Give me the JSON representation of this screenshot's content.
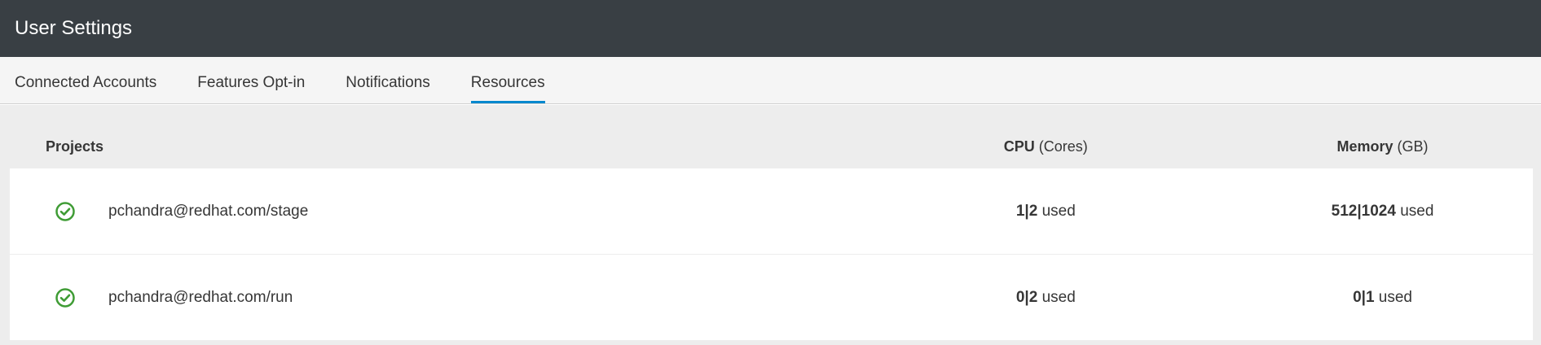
{
  "header": {
    "title": "User Settings"
  },
  "tabs": [
    {
      "label": "Connected Accounts"
    },
    {
      "label": "Features Opt-in"
    },
    {
      "label": "Notifications"
    },
    {
      "label": "Resources",
      "active": true
    }
  ],
  "table": {
    "columns": {
      "projects": "Projects",
      "cpu_bold": "CPU",
      "cpu_unit": "(Cores)",
      "memory_bold": "Memory",
      "memory_unit": "(GB)"
    },
    "rows": [
      {
        "status_icon": "check-circle-icon",
        "project": "pchandra@redhat.com/stage",
        "cpu_used": "1|2",
        "memory_used": "512|1024",
        "suffix": "used"
      },
      {
        "status_icon": "check-circle-icon",
        "project": "pchandra@redhat.com/run",
        "cpu_used": "0|2",
        "memory_used": "0|1",
        "suffix": "used"
      }
    ]
  },
  "colors": {
    "header_bg": "#393f44",
    "tab_active": "#0088ce",
    "status_ok": "#3f9c35"
  }
}
